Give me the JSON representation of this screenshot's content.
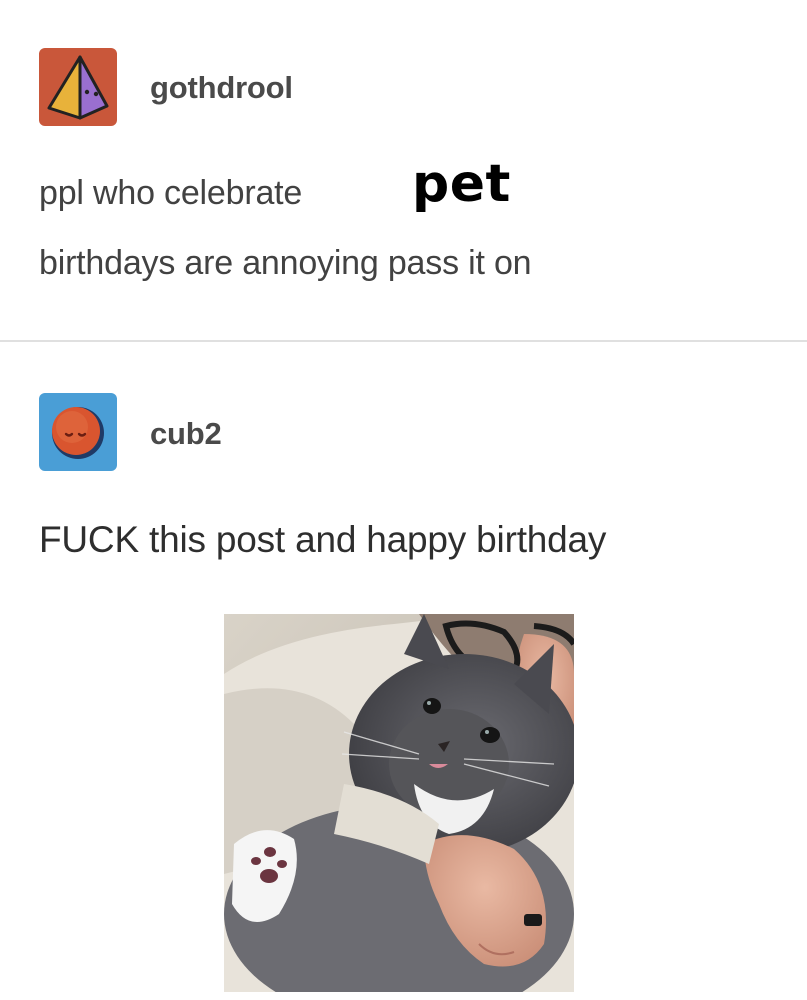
{
  "posts": [
    {
      "username": "gothdrool",
      "avatar_icon": "triangle-avatar-icon",
      "avatar_colors": {
        "background": "#c9573a",
        "left_face": "#e8b23a",
        "right_face": "#9a6fd0"
      },
      "body_line_1": "ppl who celebrate",
      "overlay_word": "pet",
      "body_line_2": "birthdays are annoying pass it on"
    },
    {
      "username": "cub2",
      "avatar_icon": "sleepy-moon-avatar-icon",
      "avatar_colors": {
        "background": "#4a9ed6",
        "circle": "#d9552f"
      },
      "body": "FUCK this post and happy birthday",
      "photo": {
        "subject": "cat-photo"
      }
    }
  ],
  "colors": {
    "divider": "#e0e0e0",
    "text": "#424242"
  }
}
